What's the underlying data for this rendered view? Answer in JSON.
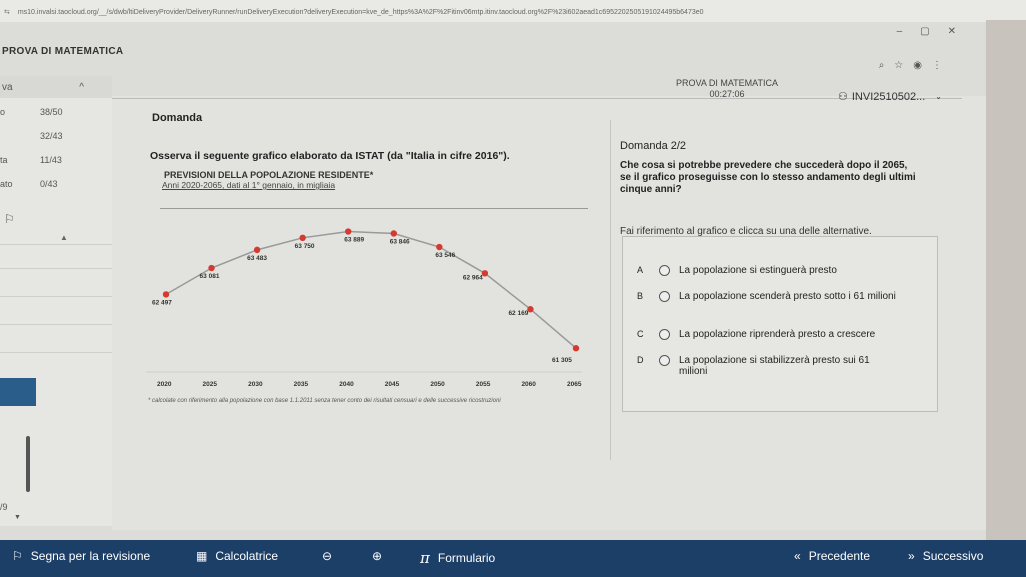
{
  "browser": {
    "url": "ms10.invalsi.taocloud.org/__/s/dwb/ltiDeliveryProvider/DeliveryRunner/runDeliveryExecution?deliveryExecution=kve_de_https%3A%2F%2Fitinv06mtp.itinv.taocloud.org%2F%23i602aead1c6952202505191024495b6473e0"
  },
  "app": {
    "title": "PROVA DI MATEMATICA",
    "exam_name": "PROVA DI MATEMATICA",
    "timer": "00:27:06",
    "user": "INVI2510502..."
  },
  "sidebar": {
    "top_label": "va",
    "rows": [
      {
        "label": "o",
        "value": "38/50"
      },
      {
        "label": "",
        "value": "32/43"
      },
      {
        "label": "ta",
        "value": "11/43"
      },
      {
        "label": "ato",
        "value": "0/43"
      }
    ],
    "page_indicator": "/9"
  },
  "question_panel": {
    "section_label": "Domanda",
    "intro": "Osserva il seguente grafico elaborato da ISTAT (da \"Italia in cifre 2016\").",
    "chart_title": "PREVISIONI DELLA POPOLAZIONE RESIDENTE*",
    "chart_subtitle": "Anni 2020-2065, dati al 1° gennaio, in migliaia",
    "chart_note": "* calcolate con riferimento alla popolazione con base 1.1.2011 senza tener conto dei risultati censuari e delle successive ricostruzioni"
  },
  "chart_data": {
    "type": "line",
    "title": "PREVISIONI DELLA POPOLAZIONE RESIDENTE*",
    "subtitle": "Anni 2020-2065, dati al 1° gennaio, in migliaia",
    "x": [
      2020,
      2025,
      2030,
      2035,
      2040,
      2045,
      2050,
      2055,
      2060,
      2065
    ],
    "values": [
      62497,
      63081,
      63483,
      63750,
      63889,
      63846,
      63546,
      62964,
      62169,
      61305
    ],
    "labels": [
      "62 497",
      "63 081",
      "63 483",
      "63 750",
      "63 889",
      "63 846",
      "63 546",
      "62 964",
      "62 169",
      "61 305"
    ],
    "ylim": [
      61000,
      64100
    ],
    "line_color": "#999999",
    "marker_color": "#d43a2f",
    "grid": false
  },
  "answer_panel": {
    "question_number": "Domanda 2/2",
    "question": "Che cosa si potrebbe prevedere che succederà dopo il 2065, se il grafico proseguisse con lo stesso andamento degli ultimi cinque anni?",
    "instruction": "Fai riferimento al grafico e clicca su una delle alternative.",
    "options": [
      {
        "letter": "A",
        "text": "La popolazione si estinguerà presto"
      },
      {
        "letter": "B",
        "text": "La popolazione scenderà presto sotto i 61 milioni"
      },
      {
        "letter": "C",
        "text": "La popolazione riprenderà presto a crescere"
      },
      {
        "letter": "D",
        "text": "La popolazione si stabilizzerà presto sui 61 milioni"
      }
    ]
  },
  "bottom_bar": {
    "review": "Segna per la revisione",
    "calculator": "Calcolatrice",
    "formulary": "Formulario",
    "previous": "Precedente",
    "next": "Successivo"
  },
  "colors": {
    "bottom_bar": "#1c3f68",
    "accent_blue": "#2b5d8a"
  }
}
